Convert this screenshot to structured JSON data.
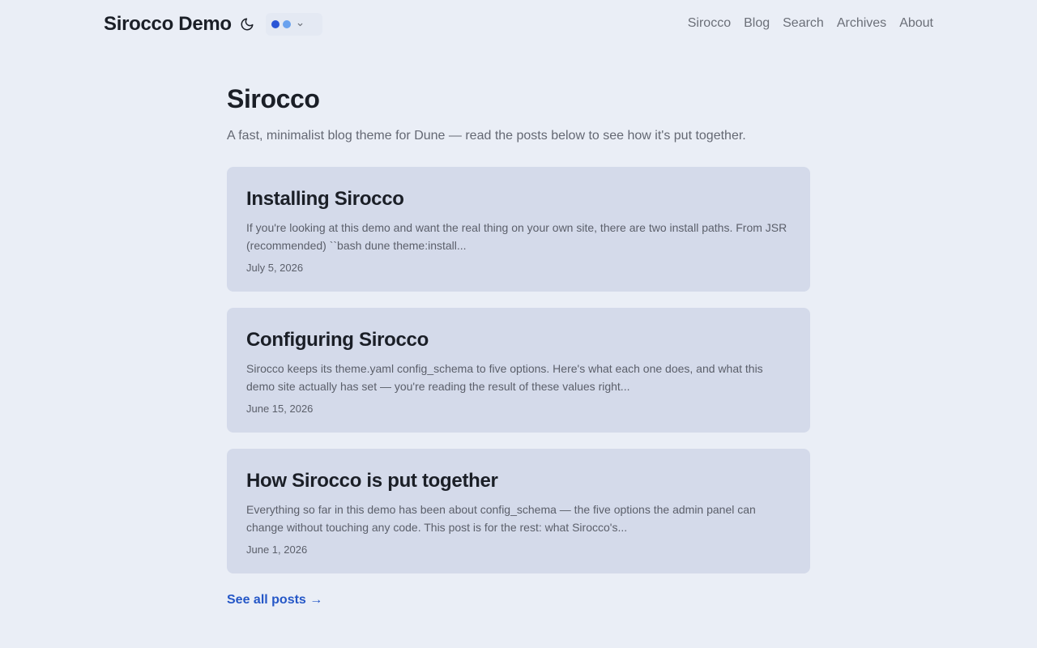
{
  "header": {
    "site_title": "Sirocco Demo",
    "theme_toggle_icon": "moon-icon",
    "palette": {
      "colors": [
        "#2a55d6",
        "#6aa2ee"
      ],
      "icon": "chevron-down-icon"
    },
    "nav": [
      {
        "label": "Sirocco"
      },
      {
        "label": "Blog"
      },
      {
        "label": "Search"
      },
      {
        "label": "Archives"
      },
      {
        "label": "About"
      }
    ]
  },
  "main": {
    "title": "Sirocco",
    "intro": "A fast, minimalist blog theme for Dune — read the posts below to see how it's put together.",
    "posts": [
      {
        "title": "Installing Sirocco",
        "excerpt": "If you're looking at this demo and want the real thing on your own site, there are two install paths. From JSR (recommended) ``bash dune theme:install...",
        "date": "July 5, 2026"
      },
      {
        "title": "Configuring Sirocco",
        "excerpt": "Sirocco keeps its theme.yaml config_schema to five options. Here's what each one does, and what this demo site actually has set — you're reading the result of these values right...",
        "date": "June 15, 2026"
      },
      {
        "title": "How Sirocco is put together",
        "excerpt": "Everything so far in this demo has been about config_schema — the five options the admin panel can change without touching any code. This post is for the rest: what Sirocco's...",
        "date": "June 1, 2026"
      }
    ],
    "see_all": "See all posts →"
  },
  "colors": {
    "background": "#eaeef6",
    "card": "#d4daea",
    "link": "#2557c7",
    "muted_text": "#646873"
  }
}
